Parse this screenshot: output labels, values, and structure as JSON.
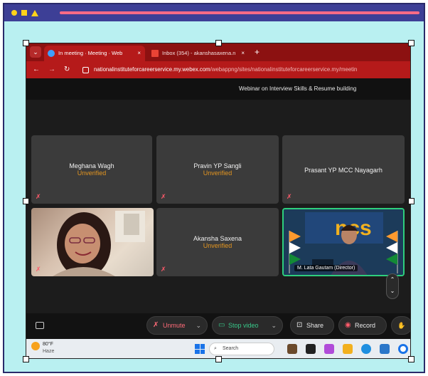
{
  "browser": {
    "tabs": [
      {
        "label": "In meeting · Meeting · Web",
        "active": true
      },
      {
        "label": "Inbox (354) - akanshasaxena.n",
        "active": false
      }
    ],
    "new_tab": "+",
    "tab_close": "×",
    "url_host": "nationalinstituteforcareerservice.my.webex.com",
    "url_path": "/webappng/sites/nationalinstituteforcareerservice.my/meetin"
  },
  "meeting": {
    "title": "Webinar on Interview Skills & Resume building",
    "participants": [
      {
        "name": "Meghana Wagh",
        "status": "Unverified"
      },
      {
        "name": "Pravin YP Sangli",
        "status": "Unverified"
      },
      {
        "name": "Prasant YP MCC Nayagarh",
        "status": ""
      },
      {
        "name": "Akansha Saxena",
        "status": "Unverified"
      }
    ],
    "presenter_label": "M. Lata Gautam (Director)",
    "banner_text": "ncs"
  },
  "controls": {
    "unmute": "Unmute",
    "stop_video": "Stop video",
    "share": "Share",
    "record": "Record"
  },
  "taskbar": {
    "temp": "80°F",
    "weather": "Haze",
    "search_placeholder": "Search"
  },
  "colors": {
    "frame_bg": "#b9f0f1",
    "frame_bar": "#3d3f96",
    "browser_red": "#b51a1a",
    "unverified": "#e39520"
  }
}
